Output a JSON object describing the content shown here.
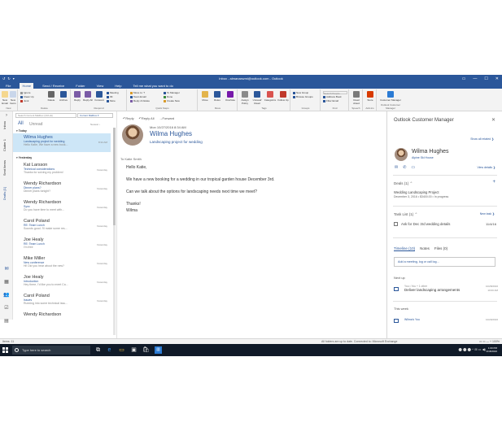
{
  "window": {
    "title": "Inbox - almanaxwmi@outlook.com - Outlook",
    "qat": [
      "↺",
      "↻",
      "▾"
    ],
    "controls": [
      "▭",
      "—",
      "☐",
      "✕"
    ]
  },
  "ribbon_tabs": [
    "File",
    "Home",
    "Send / Receive",
    "Folder",
    "View",
    "Help",
    "Tell me what you want to do"
  ],
  "ribbon": {
    "new_email": "New Email",
    "new_items": "New Items",
    "group_new": "New",
    "ignore": "Ignore",
    "clean_up": "Clean Up",
    "junk": "Junk",
    "delete": "Delete",
    "archive": "Archive",
    "group_delete": "Delete",
    "reply": "Reply",
    "reply_all": "Reply All",
    "forward": "Forward",
    "meeting": "Meeting",
    "im": "IM",
    "more": "More",
    "group_respond": "Respond",
    "qs1": "Move to: ?",
    "qs2": "Team Email",
    "qs3": "Reply & Delete",
    "qs4": "To Manager",
    "qs5": "Done",
    "qs6": "Create New",
    "group_quicksteps": "Quick Steps",
    "move": "Move",
    "rules": "Rules",
    "onenote": "OneNote",
    "group_move": "Move",
    "assign_policy": "Assign Policy",
    "unread_read": "Unread/ Read",
    "categorize": "Categorize",
    "follow_up": "Follow Up",
    "group_tags": "Tags",
    "new_group": "New Group",
    "browse_groups": "Browse Groups",
    "group_groups": "Groups",
    "search_people": "Search People",
    "address_book": "Address Book",
    "filter_email": "Filter Email",
    "group_find": "Find",
    "read_aloud": "Read Aloud",
    "group_speech": "Speech",
    "store": "Store",
    "group_addins": "Add-ins",
    "customer_manager": "Customer Manager",
    "group_ocm": "Outlook Customer Manager"
  },
  "rail": {
    "inbox": "Inbox",
    "clutter": "Clutter",
    "clutter_count": "1",
    "sent_items": "Sent Items",
    "drafts": "Drafts",
    "drafts_count": "[1]",
    "icons": [
      "✉",
      "▦",
      "👥",
      "☑",
      "▤"
    ]
  },
  "message_list": {
    "search_placeholder": "Search Current Mailbox (Ctrl+E)",
    "scope": "Current Mailbox ▾",
    "filter_all": "All",
    "filter_unread": "Unread",
    "sort": "Newest ↓",
    "group_today": "▾ Today",
    "group_yesterday": "▾ Yesterday",
    "items": [
      {
        "from": "Wilma Hughes",
        "subject": "Landscaping project for wedding",
        "preview": "Hello Katie, We have a new book...",
        "time": "8:34 AM",
        "selected": true
      },
      {
        "from": "Kat Larsson",
        "subject": "Technical considerations",
        "preview": "Thanks for solving my problem!",
        "time": "Yesterday",
        "selected": false
      },
      {
        "from": "Wendy Richardson",
        "subject": "Dinner plans?",
        "preview": "Dinner plans tonight?",
        "time": "Yesterday",
        "selected": false
      },
      {
        "from": "Wendy Richardson",
        "subject": "Sync",
        "preview": "Do you have time to meet with...",
        "time": "Yesterday",
        "selected": false
      },
      {
        "from": "Carol Poland",
        "subject": "RE: Team Lunch",
        "preview": "Sounds good. I'll make some res...",
        "time": "Yesterday",
        "selected": false
      },
      {
        "from": "Joe Healy",
        "subject": "RE: Team Lunch",
        "preview": "I'm free",
        "time": "Yesterday",
        "selected": false
      },
      {
        "from": "Mike Miller",
        "subject": "New conference",
        "preview": "Hi! Did you hear about the new?",
        "time": "Yesterday",
        "selected": false
      },
      {
        "from": "Joe Healy",
        "subject": "Introduction",
        "preview": "Hey there, I'd like you to meet Ca...",
        "time": "Yesterday",
        "selected": false
      },
      {
        "from": "Carol Poland",
        "subject": "Issues",
        "preview": "Running into some technical issu...",
        "time": "Yesterday",
        "selected": false
      },
      {
        "from": "Wendy Richardson",
        "subject": "",
        "preview": "",
        "time": "",
        "selected": false
      }
    ]
  },
  "reading": {
    "reply": "↶Reply",
    "reply_all": "↶Reply All",
    "forward": "→Forward",
    "date": "Mon 10/27/2016 8:34 AM",
    "sender": "Wilma Hughes",
    "subject": "Landscaping project for wedding",
    "to": "To  Katie Smith",
    "body": [
      "Hello Katie,",
      "We have a new booking for a wedding in our tropical garden house December 3rd.",
      "Can we talk about the options for landscaping needs next time we meet?",
      "Thanks!\nWilma"
    ]
  },
  "ocm": {
    "title": "Outlook Customer Manager",
    "close": "✕",
    "show_all": "Show all related ❯",
    "contact_name": "Wilma Hughes",
    "contact_org": "Alpine Ski House",
    "contact_icons": [
      "✉",
      "✆",
      "▭"
    ],
    "view_details": "View details ❯",
    "deals_head": "Deals (1) ⌃",
    "deal_name": "Wedding Landscaping Project",
    "deal_info": "December 3, 2016 • $3400.00 • In progress",
    "task_head": "Task List (1) ⌃",
    "new_task": "New task ❯",
    "task_text": "Ask for Dec 3rd wedding details",
    "task_due": "11/4/16",
    "feed_tabs": [
      "Timeline (10)",
      "Notes",
      "Files (0)"
    ],
    "add_meeting": "Add a meeting, log or call log...",
    "next_up": "Next up",
    "ev1_l1": "You • You + 1 other",
    "ev1_l2": "Deliver landscaping arrangements",
    "ev1_r1": "10/28/2016",
    "ev1_r2": "10:00 AM",
    "this_week": "This week",
    "ev2_l1": "Wilma's You",
    "ev2_r1": "10/29/2016"
  },
  "status": {
    "items": "Items: 11",
    "sync": "All folders are up to date.    Connected to: Microsoft Exchange",
    "zoom": "▭ ▭  —  +  100%"
  },
  "taskbar": {
    "search": "Type here to search",
    "apps": [
      "⧉",
      "e",
      "▭",
      "▣",
      "🛍",
      "e",
      "▥"
    ],
    "tray": "⬤  ⬤  ⬤  ^  ⊞  ▭  ◀)",
    "time": "1:00 PM",
    "date": "4/18/2016"
  }
}
